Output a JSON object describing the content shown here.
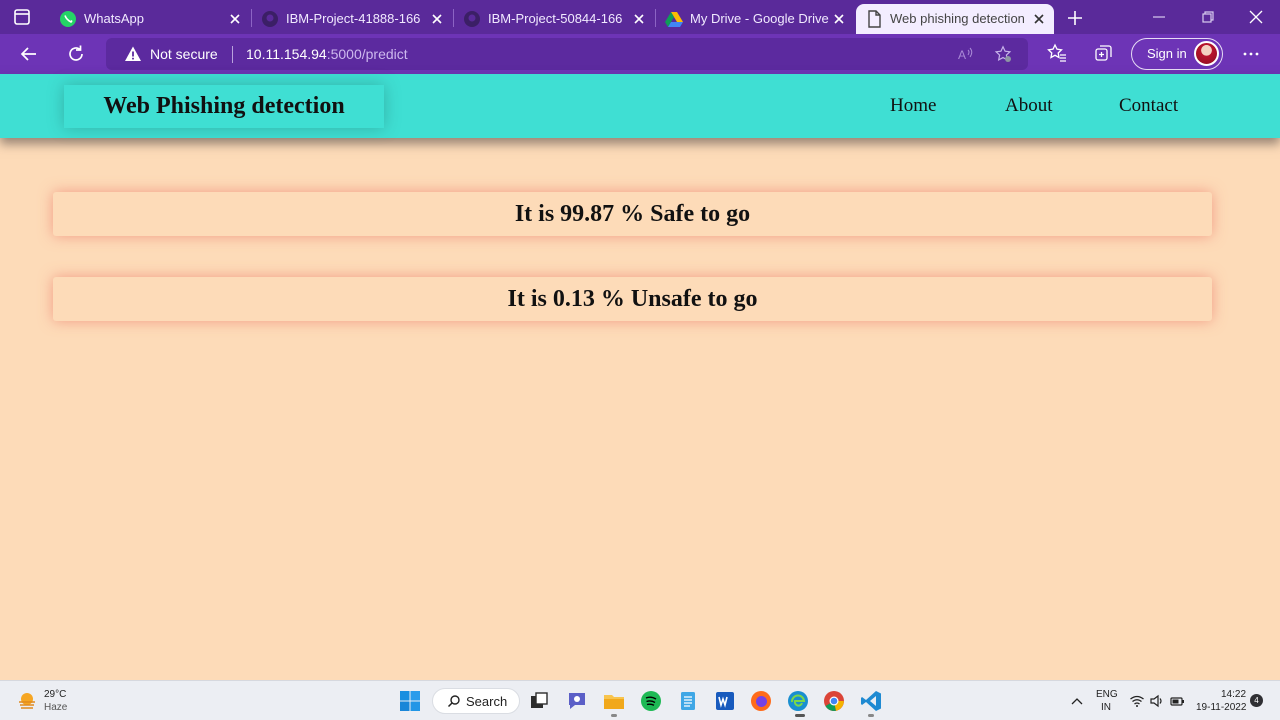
{
  "browser": {
    "tabs": [
      {
        "title": "WhatsApp",
        "icon": "whatsapp-icon",
        "active": false
      },
      {
        "title": "IBM-Project-41888-166",
        "icon": "github-icon",
        "active": false
      },
      {
        "title": "IBM-Project-50844-166",
        "icon": "github-icon",
        "active": false
      },
      {
        "title": "My Drive - Google Drive",
        "icon": "google-drive-icon",
        "active": false
      },
      {
        "title": "Web phishing detection",
        "icon": "document-icon",
        "active": true
      }
    ],
    "security_label": "Not secure",
    "url_host": "10.11.154.94",
    "url_rest": ":5000/predict",
    "signin_label": "Sign in",
    "colors": {
      "tabstrip": "#5a2a9a",
      "toolbar": "#6d34b6"
    }
  },
  "page": {
    "brand": "Web Phishing detection",
    "nav": [
      {
        "label": "Home"
      },
      {
        "label": "About"
      },
      {
        "label": "Contact"
      }
    ],
    "results": [
      {
        "text": "It is 99.87 % Safe to go"
      },
      {
        "text": "It is 0.13 % Unsafe to go"
      }
    ],
    "colors": {
      "header": "#3fdfd3",
      "background": "#fddbb8",
      "glow": "#f08c78"
    }
  },
  "taskbar": {
    "weather": {
      "temp": "29°C",
      "condition": "Haze"
    },
    "search_label": "Search",
    "apps": [
      "start-icon",
      "task-view-icon",
      "teams-chat-icon",
      "file-explorer-icon",
      "spotify-icon",
      "notepad-icon",
      "word-icon",
      "firefox-icon",
      "edge-icon",
      "chrome-icon",
      "vscode-icon"
    ],
    "language": "ENG",
    "region": "IN",
    "time": "14:22",
    "date": "19-11-2022",
    "notification_count": "4"
  }
}
